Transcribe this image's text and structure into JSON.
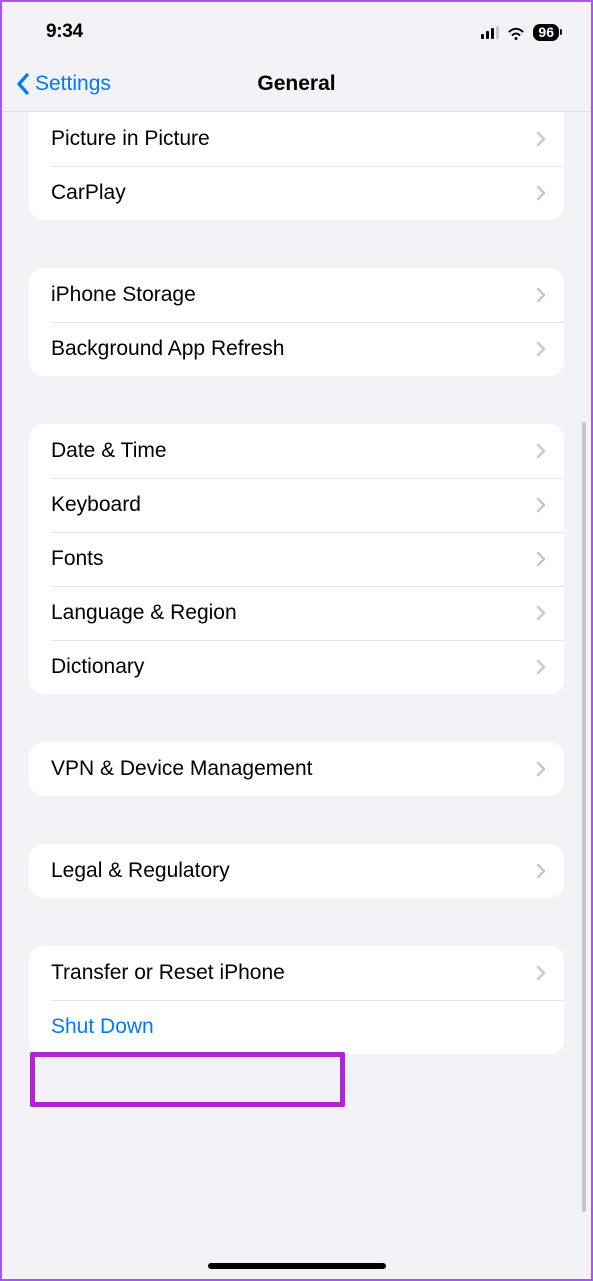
{
  "status": {
    "time": "9:34",
    "battery": "96"
  },
  "nav": {
    "back_label": "Settings",
    "title": "General"
  },
  "groups": [
    {
      "rows": [
        {
          "label": "Picture in Picture",
          "chevron": true
        },
        {
          "label": "CarPlay",
          "chevron": true
        }
      ]
    },
    {
      "rows": [
        {
          "label": "iPhone Storage",
          "chevron": true
        },
        {
          "label": "Background App Refresh",
          "chevron": true
        }
      ]
    },
    {
      "rows": [
        {
          "label": "Date & Time",
          "chevron": true
        },
        {
          "label": "Keyboard",
          "chevron": true
        },
        {
          "label": "Fonts",
          "chevron": true
        },
        {
          "label": "Language & Region",
          "chevron": true
        },
        {
          "label": "Dictionary",
          "chevron": true
        }
      ]
    },
    {
      "rows": [
        {
          "label": "VPN & Device Management",
          "chevron": true
        }
      ]
    },
    {
      "rows": [
        {
          "label": "Legal & Regulatory",
          "chevron": true
        }
      ]
    },
    {
      "rows": [
        {
          "label": "Transfer or Reset iPhone",
          "chevron": true,
          "highlighted": true
        },
        {
          "label": "Shut Down",
          "chevron": false,
          "style": "link"
        }
      ]
    }
  ]
}
